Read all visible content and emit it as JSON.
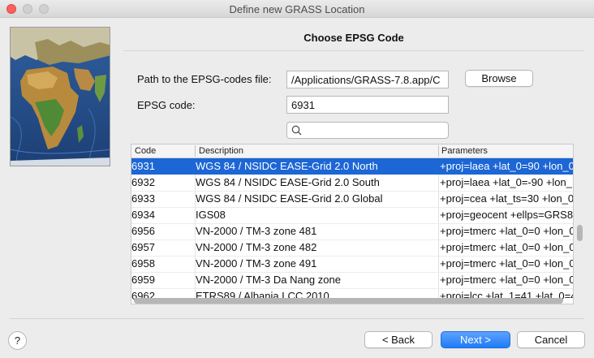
{
  "window": {
    "title": "Define new GRASS Location"
  },
  "page": {
    "title": "Choose EPSG Code"
  },
  "form": {
    "path_label": "Path to the EPSG-codes file:",
    "path_value": "/Applications/GRASS-7.8.app/C",
    "browse_label": "Browse",
    "code_label": "EPSG code:",
    "code_value": "6931",
    "search_value": ""
  },
  "table": {
    "columns": [
      "Code",
      "Description",
      "Parameters"
    ],
    "selected_index": 0,
    "rows": [
      {
        "code": "6931",
        "description": "WGS 84 / NSIDC EASE-Grid 2.0 North",
        "parameters": "+proj=laea +lat_0=90 +lon_0"
      },
      {
        "code": "6932",
        "description": "WGS 84 / NSIDC EASE-Grid 2.0 South",
        "parameters": "+proj=laea +lat_0=-90 +lon_"
      },
      {
        "code": "6933",
        "description": "WGS 84 / NSIDC EASE-Grid 2.0 Global",
        "parameters": "+proj=cea +lat_ts=30 +lon_0"
      },
      {
        "code": "6934",
        "description": "IGS08",
        "parameters": "+proj=geocent +ellps=GRS80"
      },
      {
        "code": "6956",
        "description": "VN-2000 / TM-3 zone 481",
        "parameters": "+proj=tmerc +lat_0=0 +lon_0"
      },
      {
        "code": "6957",
        "description": "VN-2000 / TM-3 zone 482",
        "parameters": "+proj=tmerc +lat_0=0 +lon_0"
      },
      {
        "code": "6958",
        "description": "VN-2000 / TM-3 zone 491",
        "parameters": "+proj=tmerc +lat_0=0 +lon_0"
      },
      {
        "code": "6959",
        "description": "VN-2000 / TM-3 Da Nang zone",
        "parameters": "+proj=tmerc +lat_0=0 +lon_0"
      },
      {
        "code": "6962",
        "description": "ETRS89 / Albania LCC 2010",
        "parameters": "+proj=lcc +lat_1=41 +lat_0=4"
      }
    ]
  },
  "buttons": {
    "help": "?",
    "back": "< Back",
    "next": "Next >",
    "cancel": "Cancel"
  },
  "colors": {
    "selection": "#1c66d6",
    "primary_button": "#1f7cf5",
    "close_light": "#fc605c"
  }
}
